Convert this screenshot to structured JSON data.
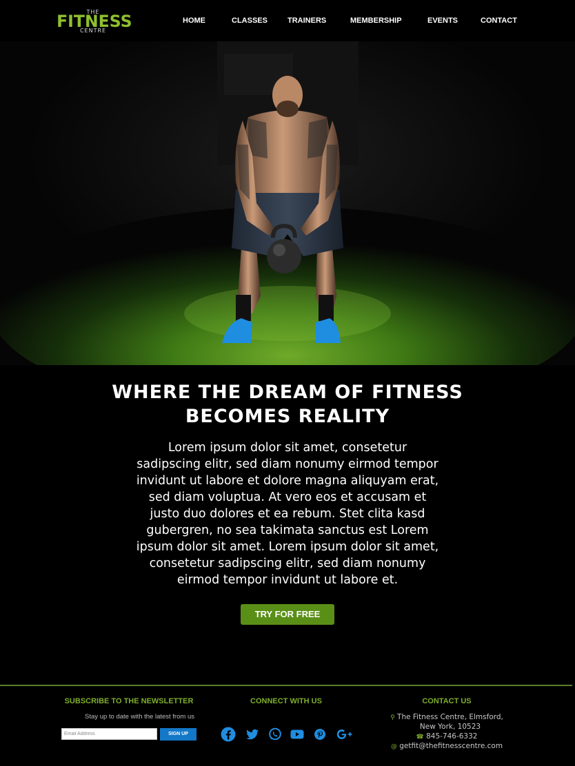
{
  "brand": {
    "logo_top": "THE",
    "logo_word": "FITNESS",
    "logo_bottom": "CENTRE",
    "accent": "#8fbf2f",
    "button_green": "#5a8f17",
    "signup_blue": "#1478c8"
  },
  "nav": {
    "items": [
      "HOME",
      "CLASSES",
      "TRAINERS",
      "MEMBERSHIP",
      "EVENTS",
      "CONTACT"
    ]
  },
  "hero": {
    "image": "man lifting kettlebell on green turf in a dark gym"
  },
  "main": {
    "headline_line1": "WHERE THE DREAM OF FITNESS",
    "headline_line2": "BECOMES REALITY",
    "body_lines": [
      "Lorem ipsum dolor sit amet, consetetur",
      "sadipscing elitr, sed diam nonumy eirmod tempor",
      "invidunt ut labore et dolore magna aliquyam erat,",
      "sed diam voluptua. At vero eos et accusam et",
      "justo duo dolores et ea rebum. Stet clita kasd",
      "gubergren, no sea takimata sanctus est Lorem",
      "ipsum dolor sit amet. Lorem ipsum dolor sit amet,",
      "consetetur sadipscing elitr, sed diam nonumy",
      "eirmod tempor invidunt ut labore et."
    ],
    "cta_label": "TRY FOR FREE"
  },
  "footer": {
    "newsletter": {
      "heading": "SUBSCRIBE TO THE NEWSLETTER",
      "subtext": "Stay up to date with the latest from us",
      "email_placeholder": "Email Address",
      "signup_label": "SIGN UP"
    },
    "connect": {
      "heading": "CONNECT WITH US",
      "icons": [
        "facebook-icon",
        "twitter-icon",
        "whatsapp-icon",
        "youtube-icon",
        "pinterest-icon",
        "google-plus-icon"
      ]
    },
    "contact": {
      "heading": "CONTACT US",
      "address_line1": "The Fitness Centre, Elmsford,",
      "address_line2": "New York, 10523",
      "phone": "845-746-6332",
      "email": "getfit@thefitnesscentre.com"
    }
  }
}
